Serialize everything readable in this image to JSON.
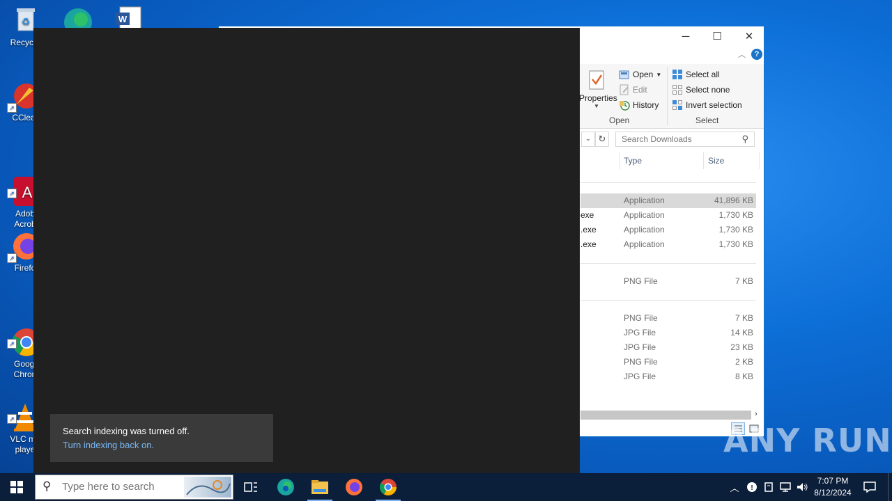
{
  "desktop": {
    "icons": [
      {
        "label": "Recycle",
        "icon": "recycle-bin-icon"
      },
      {
        "label": "CClear",
        "icon": "ccleaner-icon"
      },
      {
        "label": "Adob\nAcrob",
        "icon": "acrobat-icon"
      },
      {
        "label": "Firefo",
        "icon": "firefox-icon"
      },
      {
        "label": "Googl\nChron",
        "icon": "chrome-icon"
      },
      {
        "label": "VLC me\nplaye",
        "icon": "vlc-icon"
      }
    ]
  },
  "explorer": {
    "ribbon": {
      "properties": "Properties",
      "open": "Open",
      "edit": "Edit",
      "history": "History",
      "select_all": "Select all",
      "select_none": "Select none",
      "invert_selection": "Invert selection",
      "group_open": "Open",
      "group_select": "Select"
    },
    "search": {
      "placeholder": "Search Downloads"
    },
    "columns": {
      "type": "Type",
      "size": "Size"
    },
    "rows": [
      {
        "name": "",
        "type": "Application",
        "size": "41,896 KB",
        "selected": true
      },
      {
        "name": "exe",
        "type": "Application",
        "size": "1,730 KB"
      },
      {
        "name": ".exe",
        "type": "Application",
        "size": "1,730 KB"
      },
      {
        "name": ".exe",
        "type": "Application",
        "size": "1,730 KB"
      },
      {
        "name": "",
        "type": "PNG File",
        "size": "7 KB"
      },
      {
        "name": "",
        "type": "PNG File",
        "size": "7 KB"
      },
      {
        "name": "",
        "type": "JPG File",
        "size": "14 KB"
      },
      {
        "name": "",
        "type": "JPG File",
        "size": "23 KB"
      },
      {
        "name": "",
        "type": "PNG File",
        "size": "2 KB"
      },
      {
        "name": "",
        "type": "JPG File",
        "size": "8 KB"
      }
    ]
  },
  "toast": {
    "message": "Search indexing was turned off.",
    "link": "Turn indexing back on."
  },
  "taskbar": {
    "search_placeholder": "Type here to search",
    "time": "7:07 PM",
    "date": "8/12/2024"
  },
  "watermark": "ANY RUN",
  "colors": {
    "accent": "#0078d7",
    "taskbar": "#0b1e3a",
    "dark_panel": "#202020"
  }
}
